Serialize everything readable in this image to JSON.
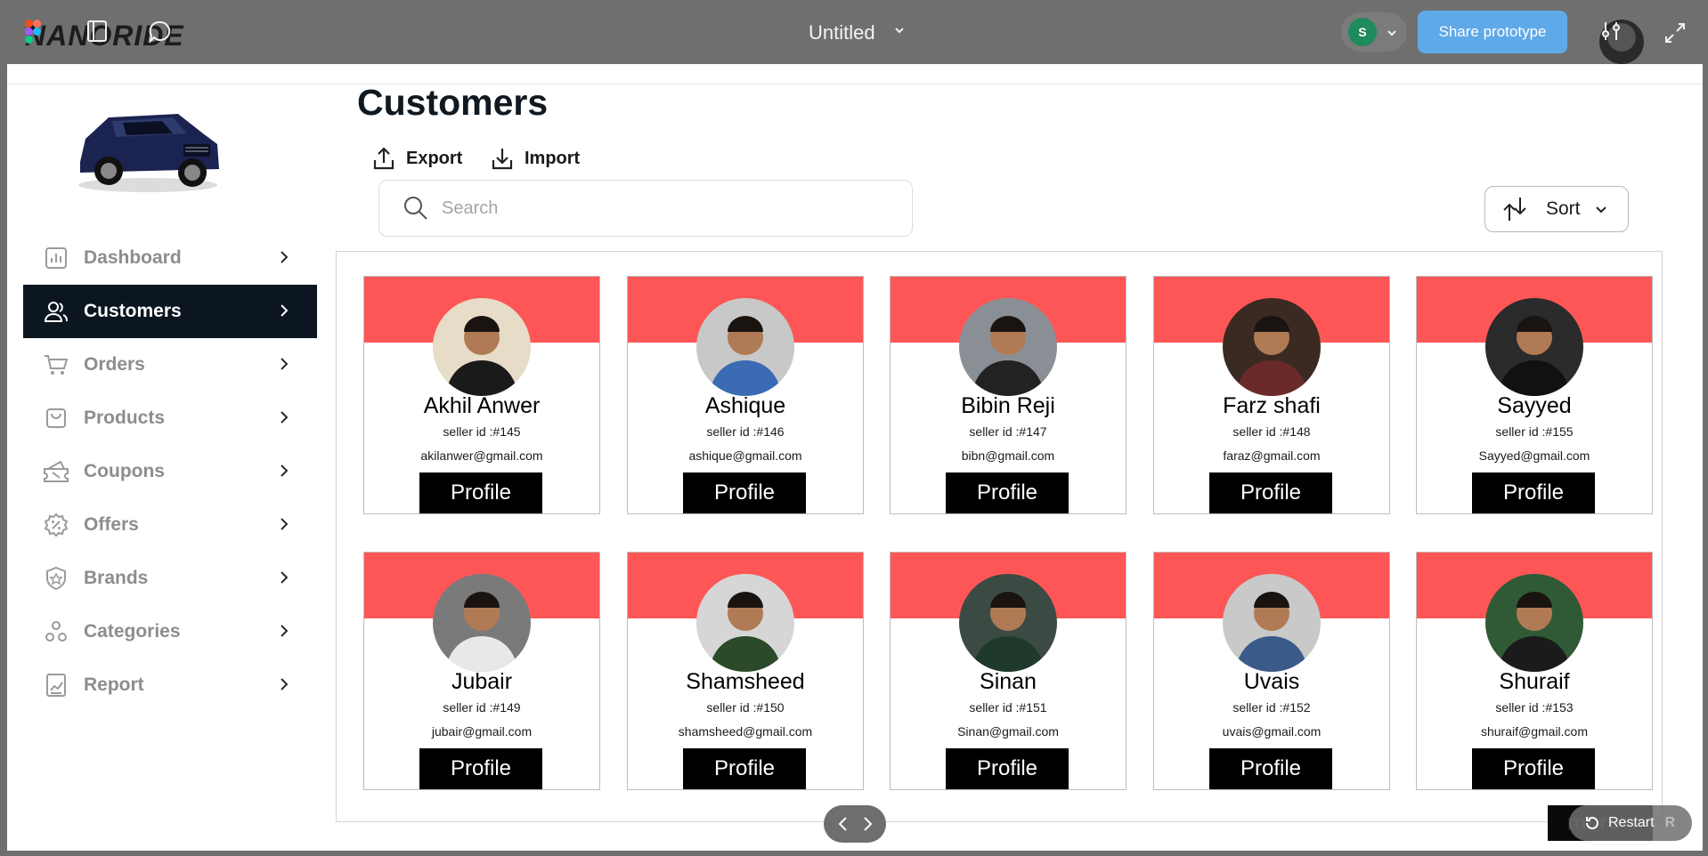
{
  "figma_bar": {
    "brand": "NANORIDE",
    "file_title": "Untitled",
    "user_initial": "S",
    "share_label": "Share prototype",
    "restart_label": "Restart",
    "restart_key": "R",
    "more_label": "more",
    "accent_color": "#5ea9e8"
  },
  "sidebar": {
    "items": [
      {
        "label": "Dashboard",
        "icon": "bar-chart-icon"
      },
      {
        "label": "Customers",
        "icon": "users-icon",
        "active": true
      },
      {
        "label": "Orders",
        "icon": "cart-icon"
      },
      {
        "label": "Products",
        "icon": "bag-icon"
      },
      {
        "label": "Coupons",
        "icon": "coupon-icon"
      },
      {
        "label": "Offers",
        "icon": "offer-badge-icon"
      },
      {
        "label": "Brands",
        "icon": "brand-shield-icon"
      },
      {
        "label": "Categories",
        "icon": "categories-icon"
      },
      {
        "label": "Report",
        "icon": "report-icon"
      }
    ]
  },
  "main": {
    "title": "Customers",
    "export_label": "Export",
    "import_label": "Import",
    "search_placeholder": "Search",
    "sort_label": "Sort",
    "band_color": "#fe5656",
    "profile_label": "Profile",
    "customers": [
      {
        "name": "Akhil Anwer",
        "seller_id": "seller id :#145",
        "email": "akilanwer@gmail.com"
      },
      {
        "name": "Ashique",
        "seller_id": "seller id :#146",
        "email": "ashique@gmail.com"
      },
      {
        "name": "Bibin Reji",
        "seller_id": "seller id :#147",
        "email": "bibn@gmail.com"
      },
      {
        "name": "Farz shafi",
        "seller_id": "seller id :#148",
        "email": "faraz@gmail.com"
      },
      {
        "name": "Sayyed",
        "seller_id": "seller id :#155",
        "email": "Sayyed@gmail.com"
      },
      {
        "name": "Jubair",
        "seller_id": "seller id :#149",
        "email": "jubair@gmail.com"
      },
      {
        "name": "Shamsheed",
        "seller_id": "seller id :#150",
        "email": "shamsheed@gmail.com"
      },
      {
        "name": "Sinan",
        "seller_id": "seller id :#151",
        "email": "Sinan@gmail.com"
      },
      {
        "name": "Uvais",
        "seller_id": "seller id :#152",
        "email": "uvais@gmail.com"
      },
      {
        "name": "Shuraif",
        "seller_id": "seller id :#153",
        "email": "shuraif@gmail.com"
      }
    ]
  }
}
